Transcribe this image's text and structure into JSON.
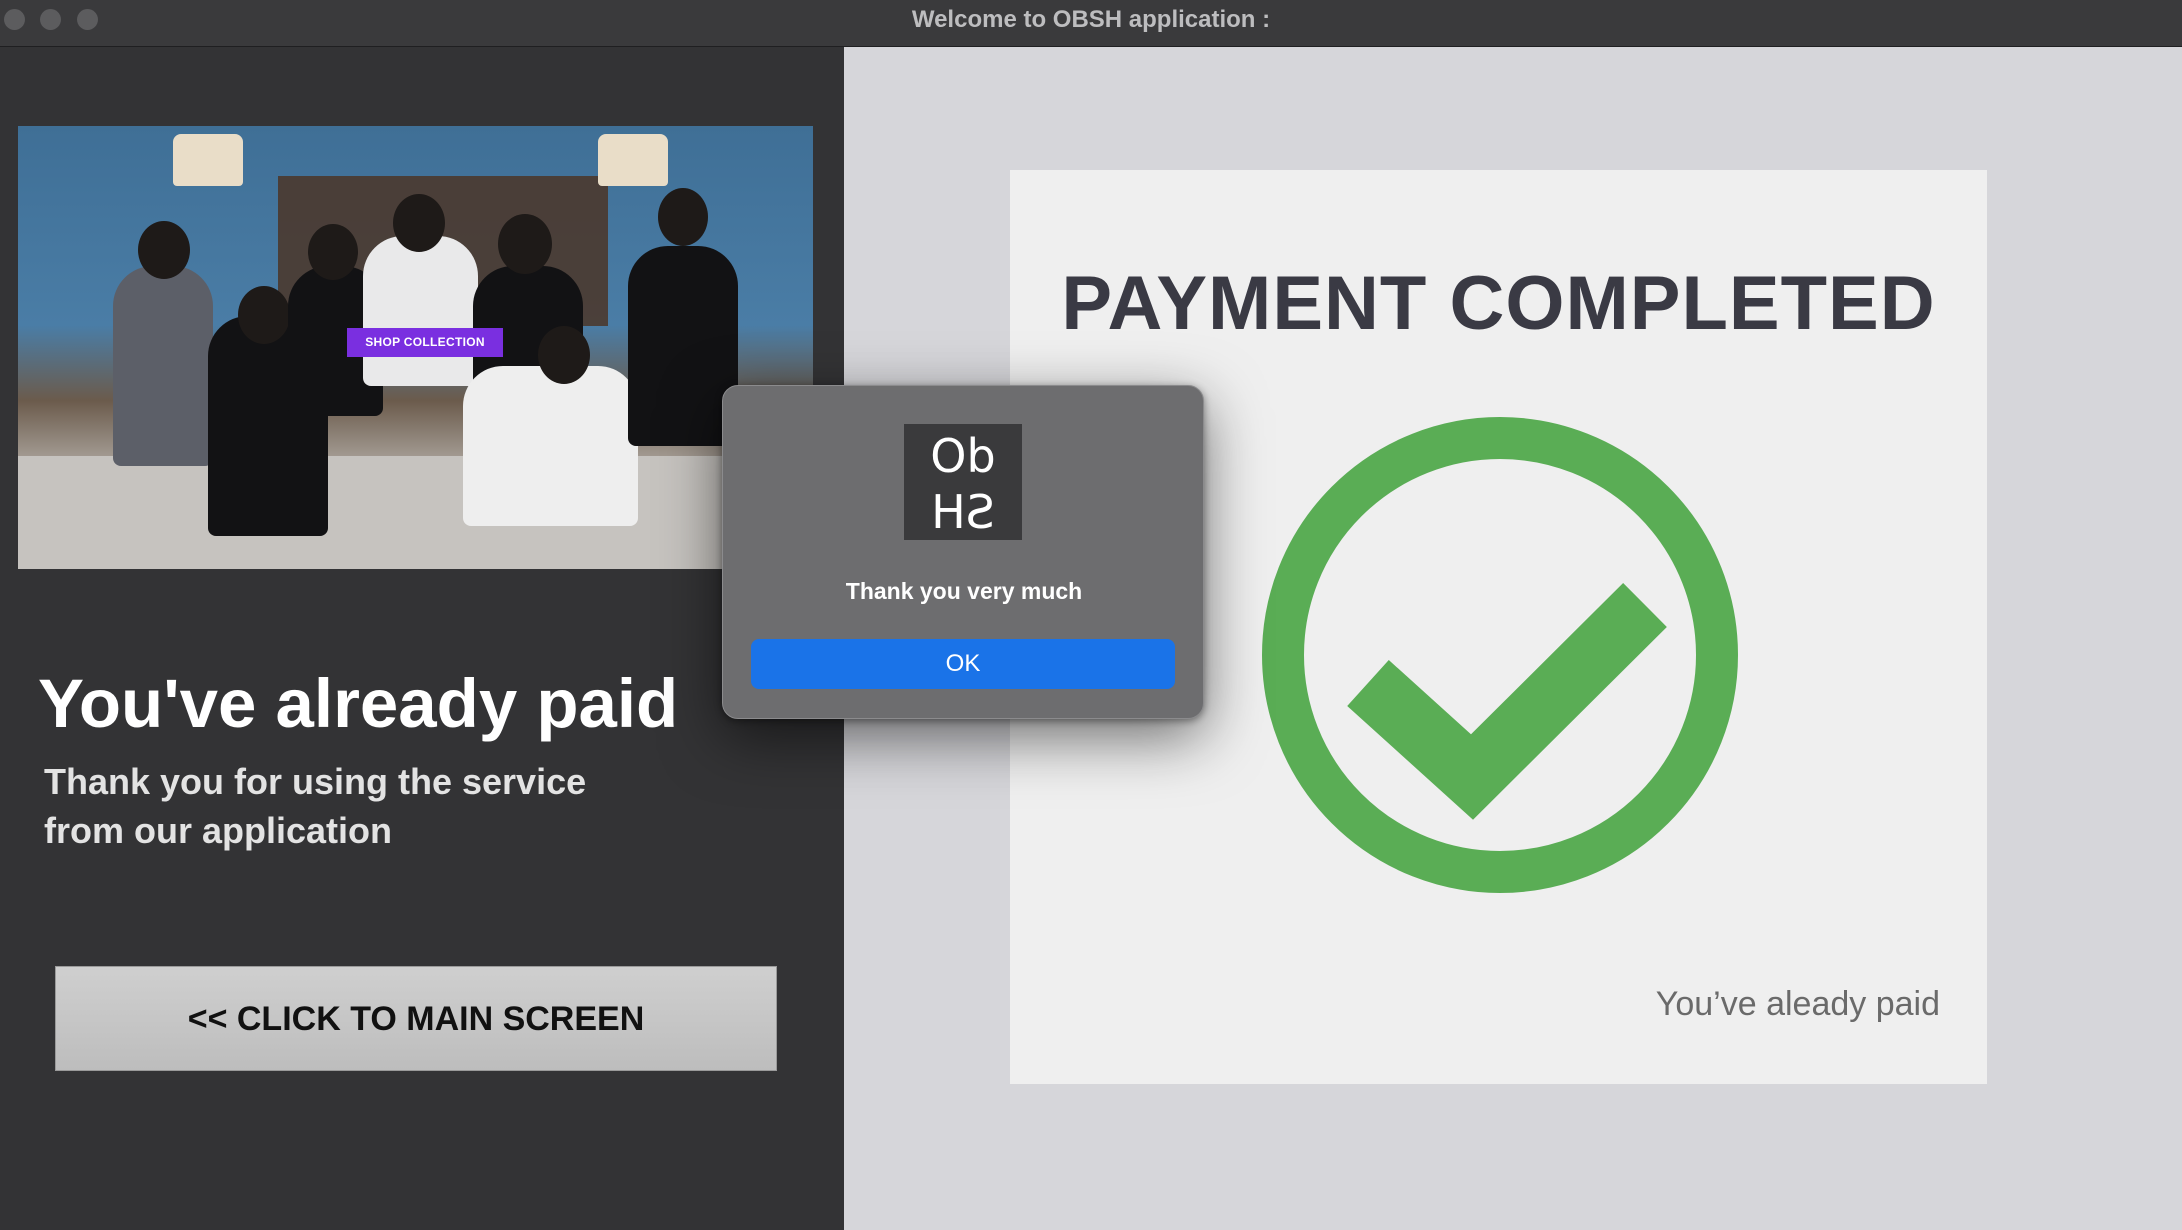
{
  "window": {
    "title": "Welcome to OBSH application :"
  },
  "left_panel": {
    "banner_badge": "SHOP COLLECTION",
    "headline": "You've already paid",
    "subtext_line1": "Thank you for using the service",
    "subtext_line2": "from our application",
    "main_screen_button": "<< CLICK TO MAIN SCREEN"
  },
  "right_panel": {
    "payment_title": "PAYMENT COMPLETED",
    "status_note": "You’ve aleady paid",
    "check_icon": "check-circle-icon",
    "check_color": "#5aad55"
  },
  "dialog": {
    "logo_line1": "Ob",
    "logo_line2": "SH",
    "message": "Thank you very much",
    "ok_label": "OK",
    "ok_color": "#1a73e8"
  }
}
